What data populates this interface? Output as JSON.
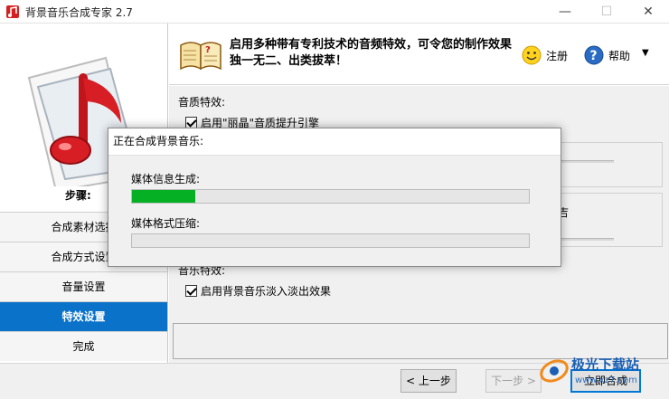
{
  "window": {
    "title": "背景音乐合成专家 2.7"
  },
  "banner": {
    "text": "启用多种带有专利技术的音频特效，可令您的制作效果独一无二、出类拔萃！",
    "register_label": "注册",
    "help_label": "帮助"
  },
  "steps": {
    "label": "步骤:",
    "items": [
      {
        "label": "合成素材选择"
      },
      {
        "label": "合成方式设置"
      },
      {
        "label": "音量设置"
      },
      {
        "label": "特效设置"
      },
      {
        "label": "完成"
      }
    ],
    "active_index": 3
  },
  "content": {
    "group_quality": "音质特效:",
    "checkbox_enhance": "启用\"丽晶\"音质提升引擎",
    "group_music": "音乐特效:",
    "checkbox_fade": "启用背景音乐淡入淡出效果",
    "behind_fragment": "吉"
  },
  "modal": {
    "title": "正在合成背景音乐:",
    "task1_label": "媒体信息生成:",
    "task1_progress": 0.16,
    "task2_label": "媒体格式压缩:",
    "task2_progress": 0
  },
  "buttons": {
    "prev": "< 上一步",
    "next": "下一步 >",
    "start": "立即合成"
  },
  "watermark": {
    "text": "极光下载站",
    "url": "www.xz7.com"
  },
  "colors": {
    "active_step": "#0a72c8",
    "progress": "#06b025",
    "accent": "#0078d7"
  }
}
